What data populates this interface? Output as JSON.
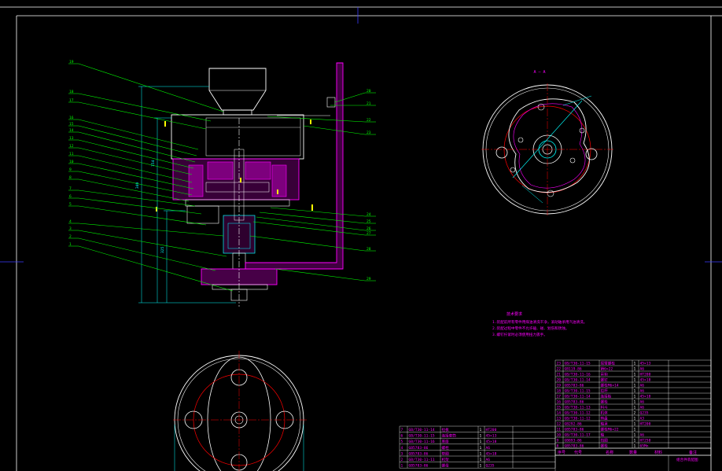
{
  "colors": {
    "background": "#000000",
    "frame": "#ffffff",
    "leader": "#00ff00",
    "dimension": "#00ffff",
    "section_hatch": "#ff00ff",
    "centerline": "#ff0000",
    "yellow": "#ffff00",
    "table_grid": "#ffffff",
    "notes": "#ff00ff"
  },
  "main_view": {
    "left_callouts": [
      "19",
      "18",
      "17",
      "16",
      "15",
      "14",
      "13",
      "12",
      "11",
      "10",
      "9",
      "8",
      "7",
      "6",
      "5",
      "4",
      "3",
      "2",
      "1"
    ],
    "right_callouts": [
      "20",
      "21",
      "22",
      "23",
      "24",
      "25",
      "26",
      "27",
      "28",
      "29"
    ],
    "dimensions": [
      "154",
      "325",
      "340"
    ]
  },
  "section_view": {
    "label": "A — A"
  },
  "tech_notes": {
    "title": "技术要求",
    "lines": [
      "1.装配前所有零件用煤油清洗干净，滚动轴承用汽油清洗。",
      "2.装配过程中零件不允许磕、碰、划伤和锈蚀。",
      "3.螺钉拧紧时必须使用扭力扳手。"
    ]
  },
  "bom_right": {
    "rows": [
      [
        "23",
        "GB/T30-11-15",
        "摇臂螺栓",
        "1",
        "45×13"
      ],
      [
        "22",
        "GB119-86",
        "销6×22",
        "1",
        "A6"
      ],
      [
        "21",
        "GB/T30-11-16",
        "吊钩",
        "1",
        "HT200"
      ],
      [
        "20",
        "GB/T30-11-14",
        "螺钉",
        "1",
        "45×18"
      ],
      [
        "19",
        "GB5783-86",
        "螺栓M6×14",
        "1",
        "A6"
      ],
      [
        "18",
        "GB/T30-11-15",
        "拉杆",
        "1",
        "A6"
      ],
      [
        "17",
        "GB/T30-11-14",
        "连接板",
        "1",
        "45×18"
      ],
      [
        "16",
        "GB5783-86",
        "螺栓",
        "1",
        "A6"
      ],
      [
        "15",
        "GB/T30-11-13",
        "料斗",
        "1",
        "A6"
      ],
      [
        "14",
        "GB/T30-11-12",
        "机体",
        "2",
        "Q235"
      ],
      [
        "13",
        "GB/T30-11-12",
        "转盘",
        "1",
        "A3"
      ],
      [
        "12",
        "GB292-86",
        "轴承",
        "1",
        "HT200"
      ],
      [
        "11",
        "GB5783-86",
        "螺栓M6×22",
        "1",
        ""
      ],
      [
        "10",
        "GB/T30-11-17",
        "轴",
        "1",
        "A6"
      ],
      [
        "9",
        "GB893-86",
        "挡圈",
        "1",
        "HT250"
      ],
      [
        "8",
        "GB5783-86",
        "螺栓",
        "1",
        "65Mn"
      ]
    ],
    "header": [
      "序号",
      "代号",
      "名称",
      "数量",
      "材料",
      "备注"
    ],
    "footer": "组合件装配图"
  },
  "bom_left": {
    "rows": [
      [
        "7",
        "GB/T30-11-14",
        "拉板",
        "1",
        "HT200"
      ],
      [
        "6",
        "GB/T30-11-15",
        "连接套筒",
        "1",
        "45×13"
      ],
      [
        "5",
        "GB/T30-11-16",
        "底座",
        "1",
        "45×18"
      ],
      [
        "4",
        "GB5783-86",
        "螺栓",
        "1",
        "A6"
      ],
      [
        "3",
        "GB5783-86",
        "垫圈",
        "1",
        "45×18"
      ],
      [
        "2",
        "GB/T30-11-11",
        "机架",
        "1",
        "A6"
      ],
      [
        "1",
        "GB5783-86",
        "螺母",
        "1",
        "Q235"
      ]
    ]
  }
}
